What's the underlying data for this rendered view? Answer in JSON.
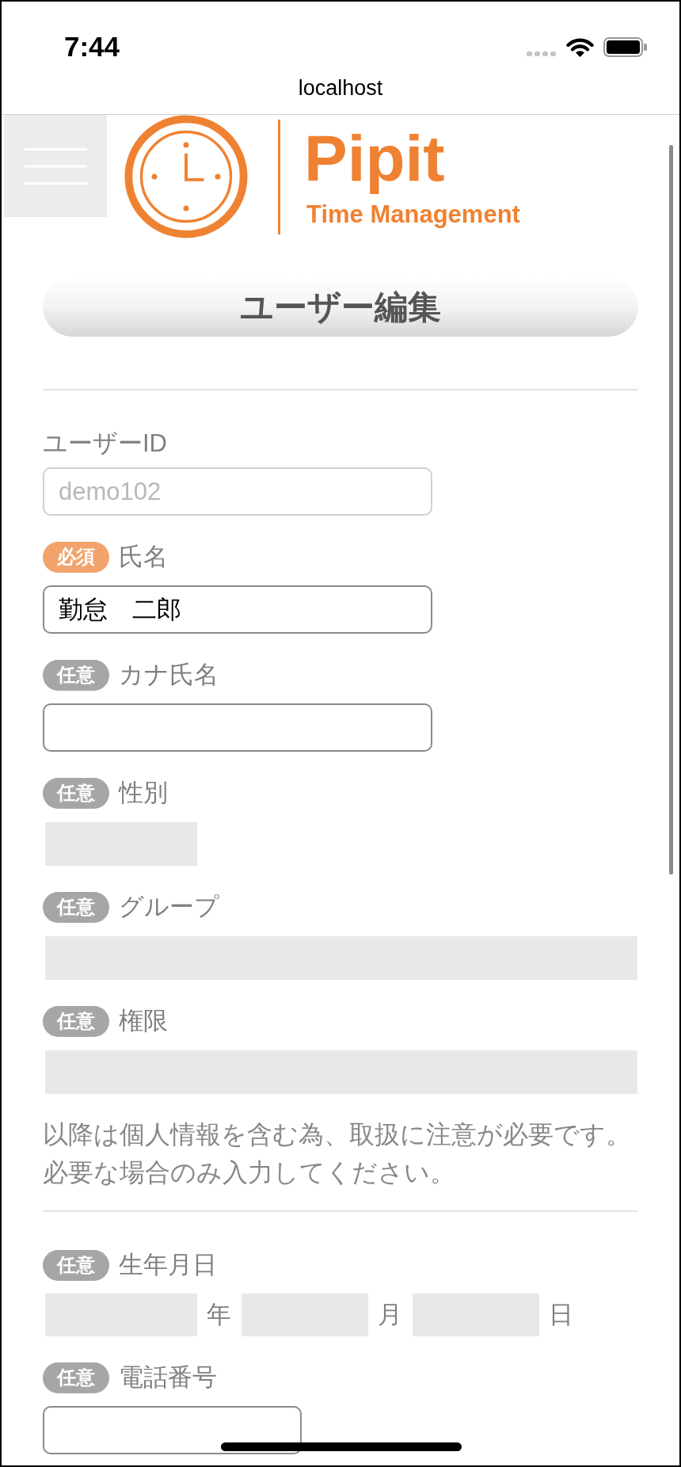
{
  "status_bar": {
    "time": "7:44"
  },
  "browser_bar": {
    "address": "localhost"
  },
  "header": {
    "logo_name": "Pipit",
    "logo_tagline": "Time Management"
  },
  "page_title": "ユーザー編集",
  "fields": [
    {
      "kind": "text",
      "label": "ユーザーID",
      "value": "demo102",
      "disabled": true
    },
    {
      "kind": "text",
      "badge": {
        "kind": "required",
        "text": "必須"
      },
      "label": "氏名",
      "value": "勤怠　二郎",
      "disabled": false
    },
    {
      "kind": "text",
      "badge": {
        "kind": "optional",
        "text": "任意"
      },
      "label": "カナ氏名",
      "disabled": false
    },
    {
      "kind": "choice",
      "badge": {
        "kind": "optional",
        "text": "任意"
      },
      "label": "性別"
    },
    {
      "kind": "select",
      "badge": {
        "kind": "optional",
        "text": "任意"
      },
      "label": "グループ"
    },
    {
      "kind": "select",
      "badge": {
        "kind": "optional",
        "text": "任意"
      },
      "label": "権限"
    }
  ],
  "notice": {
    "lines": [
      "以降は個人情報を含む為、取扱に注意が必要です。",
      "必要な場合のみ入力してください。"
    ]
  },
  "personal_fields": [
    {
      "kind": "date",
      "badge": {
        "kind": "optional",
        "text": "任意"
      },
      "label": "生年月日",
      "parts": [
        {
          "unit": "年"
        },
        {
          "unit": "月"
        },
        {
          "unit": "日"
        }
      ]
    },
    {
      "kind": "tel",
      "badge": {
        "kind": "optional",
        "text": "任意"
      },
      "label": "電話番号",
      "disabled": false
    }
  ]
}
